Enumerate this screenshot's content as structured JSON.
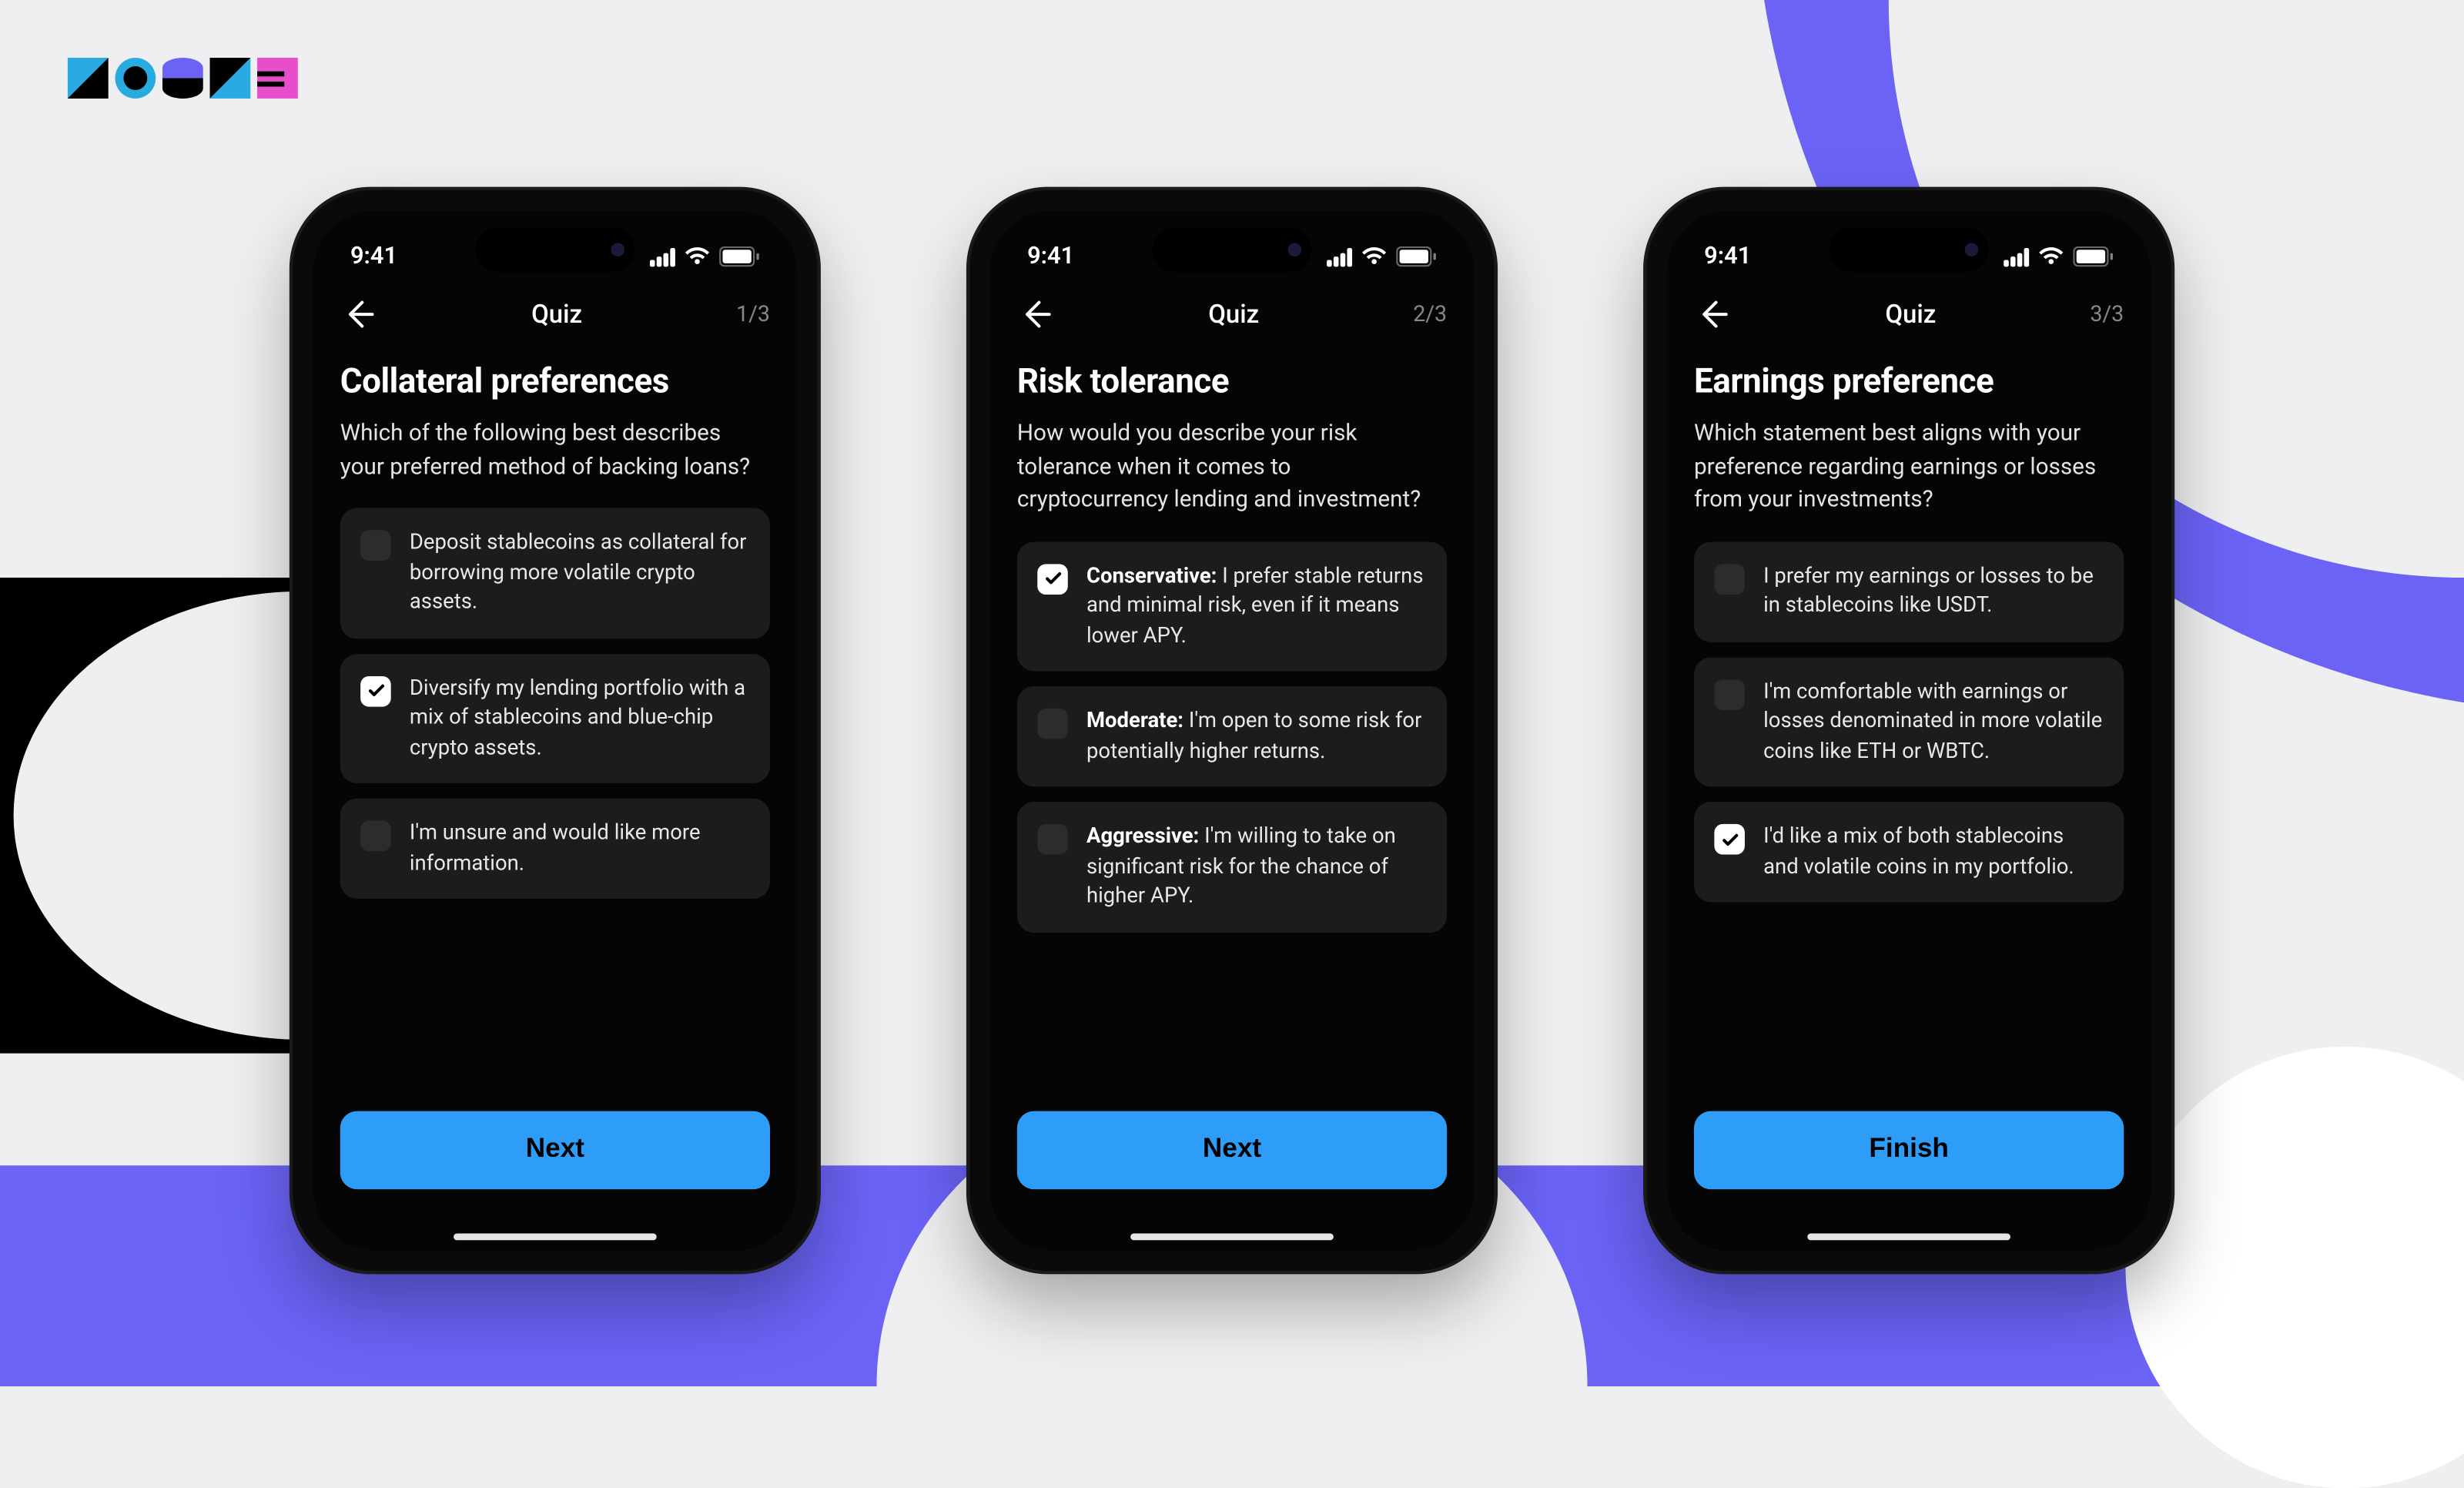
{
  "status_time": "9:41",
  "screens": [
    {
      "nav_title": "Quiz",
      "nav_count": "1/3",
      "heading": "Collateral preferences",
      "subtext": "Which of the following best describes your preferred method of backing loans?",
      "options": [
        {
          "bold": "",
          "text": "Deposit stablecoins as collateral for borrowing more volatile crypto assets.",
          "checked": false
        },
        {
          "bold": "",
          "text": "Diversify my lending portfolio with a mix of stablecoins and blue-chip crypto assets.",
          "checked": true
        },
        {
          "bold": "",
          "text": "I'm unsure and would like more information.",
          "checked": false
        }
      ],
      "cta": "Next"
    },
    {
      "nav_title": "Quiz",
      "nav_count": "2/3",
      "heading": "Risk tolerance",
      "subtext": "How would you describe your risk tolerance when it comes to cryptocurrency lending and investment?",
      "options": [
        {
          "bold": "Conservative:",
          "text": " I prefer stable returns and minimal risk, even if it means lower APY.",
          "checked": true
        },
        {
          "bold": "Moderate:",
          "text": " I'm open to some risk for potentially higher returns.",
          "checked": false
        },
        {
          "bold": "Aggressive:",
          "text": " I'm willing to take on significant risk for the chance of higher APY.",
          "checked": false
        }
      ],
      "cta": "Next"
    },
    {
      "nav_title": "Quiz",
      "nav_count": "3/3",
      "heading": "Earnings preference",
      "subtext": "Which statement best aligns with your preference regarding earnings or losses from your investments?",
      "options": [
        {
          "bold": "",
          "text": "I prefer my earnings or losses to be in stablecoins like USDT.",
          "checked": false
        },
        {
          "bold": "",
          "text": "I'm comfortable with earnings or losses denominated in more volatile coins like ETH or WBTC.",
          "checked": false
        },
        {
          "bold": "",
          "text": "I'd like a mix of both stablecoins and volatile coins in my portfolio.",
          "checked": true
        }
      ],
      "cta": "Finish"
    }
  ]
}
